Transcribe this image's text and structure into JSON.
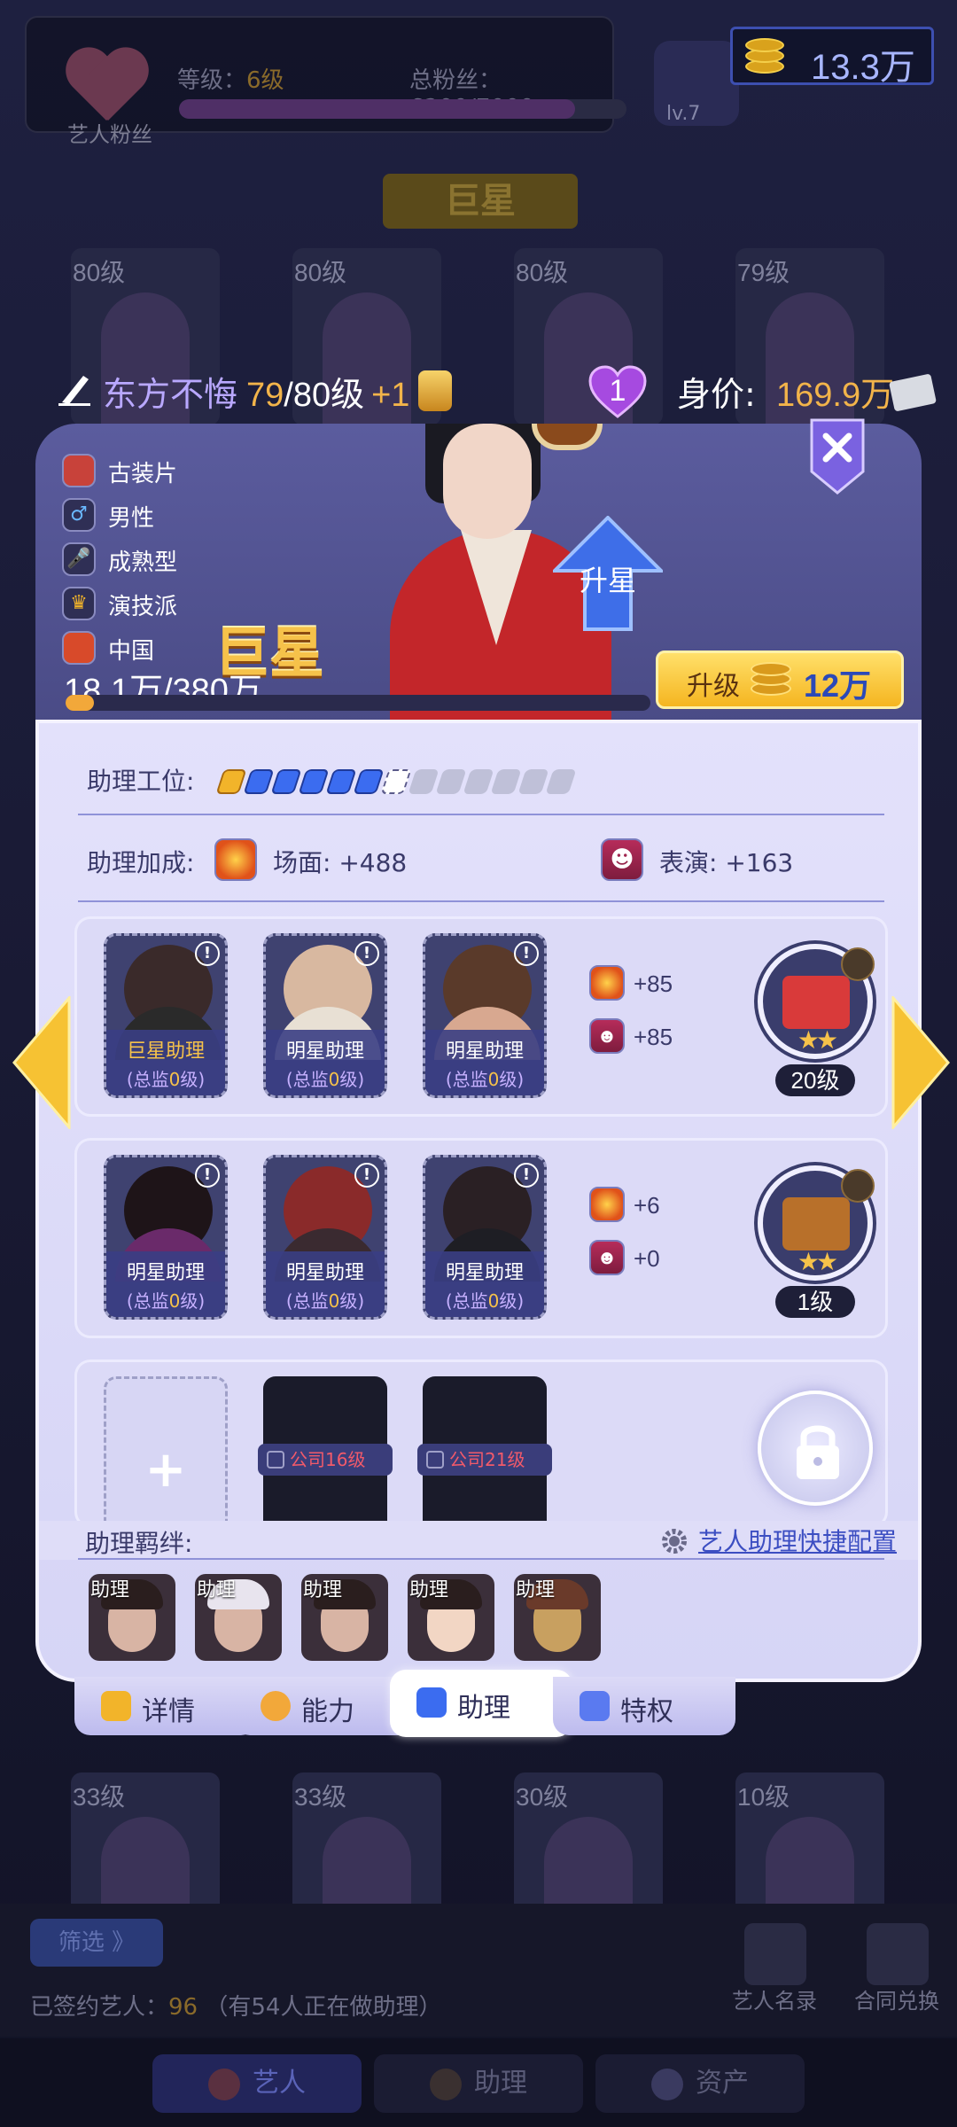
{
  "top_bar": {
    "fan_label": "艺人粉丝",
    "level_prefix": "等级：",
    "level_value": "6级",
    "total_fans_label": "总粉丝：6200/7000",
    "fan_progress": 0.886,
    "gold_amount": "13.3万",
    "company_level": "lv.7"
  },
  "rank_banner": "巨星",
  "background_cards": {
    "top_levels": [
      "80级",
      "80级",
      "80级",
      "79级"
    ],
    "bottom_levels": [
      "33级",
      "33级",
      "30级",
      "10级"
    ]
  },
  "artist": {
    "name": "东方不悔",
    "level_current": "79",
    "level_max": "/80级",
    "level_bonus": "+1",
    "hearts": "1",
    "worth_label": "身价:",
    "worth_value": "169.9万",
    "traits": [
      "古装片",
      "男性",
      "成熟型",
      "演技派",
      "中国"
    ],
    "rank": "巨星",
    "fans": "18.1万/380万",
    "fans_progress": 0.048,
    "upgrade_star_label": "升星",
    "upgrade_label": "升级",
    "upgrade_cost": "12万"
  },
  "panel": {
    "slot_label": "助理工位:",
    "slots_filled": 6,
    "slots_partial": 1,
    "slots_total": 13,
    "bonus_label": "助理加成:",
    "scene_label": "场面:",
    "scene_value": "+488",
    "acting_label": "表演:",
    "acting_value": "+163",
    "groups": [
      {
        "assistants": [
          {
            "name": "巨星助理",
            "sub_prefix": "(总监",
            "sub_level": "0",
            "sub_suffix": "级)",
            "gold": true
          },
          {
            "name": "明星助理",
            "sub_prefix": "(总监",
            "sub_level": "0",
            "sub_suffix": "级)",
            "gold": false
          },
          {
            "name": "明星助理",
            "sub_prefix": "(总监",
            "sub_level": "0",
            "sub_suffix": "级)",
            "gold": false
          }
        ],
        "scene_bonus": "+85",
        "acting_bonus": "+85",
        "equip_level": "20级",
        "equip_stars": "★★",
        "equip_color": "#d93a3a"
      },
      {
        "assistants": [
          {
            "name": "明星助理",
            "sub_prefix": "(总监",
            "sub_level": "0",
            "sub_suffix": "级)",
            "gold": false
          },
          {
            "name": "明星助理",
            "sub_prefix": "(总监",
            "sub_level": "0",
            "sub_suffix": "级)",
            "gold": false
          },
          {
            "name": "明星助理",
            "sub_prefix": "(总监",
            "sub_level": "0",
            "sub_suffix": "级)",
            "gold": false
          }
        ],
        "scene_bonus": "+6",
        "acting_bonus": "+0",
        "equip_level": "1级",
        "equip_stars": "★★",
        "equip_color": "#b8702a"
      }
    ],
    "locked_slots": [
      "公司16级",
      "公司21级"
    ],
    "add_symbol": "+",
    "bond_label": "助理羁绊:",
    "quick_config": "艺人助理快捷配置",
    "bond_tag": "助理",
    "bond_count": 5
  },
  "tabs": [
    {
      "label": "详情",
      "icon": "details-icon",
      "color": "#f2b42a"
    },
    {
      "label": "能力",
      "icon": "ability-icon",
      "color": "#f2a83a"
    },
    {
      "label": "助理",
      "icon": "assistant-icon",
      "color": "#3b6cf0"
    },
    {
      "label": "特权",
      "icon": "megaphone-icon",
      "color": "#5a7af0"
    }
  ],
  "bottom": {
    "filter": "筛选 》",
    "signed_prefix": "已签约艺人：",
    "signed_count": "96",
    "signed_note": "（有54人正在做助理）",
    "roster": "艺人名录",
    "exchange": "合同兑换",
    "nav": [
      "艺人",
      "助理",
      "资产"
    ]
  }
}
